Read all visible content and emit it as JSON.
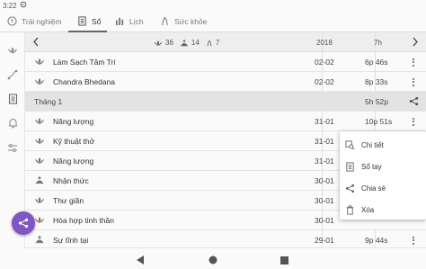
{
  "status": {
    "time": "3:22"
  },
  "tabs": [
    {
      "label": "Trải nghiệm",
      "icon": "compass-icon"
    },
    {
      "label": "Sổ",
      "icon": "journal-icon",
      "active": true
    },
    {
      "label": "Lịch",
      "icon": "bar-chart-icon"
    },
    {
      "label": "Sức khỏe",
      "icon": "health-icon"
    }
  ],
  "header": {
    "counts": [
      "36",
      "14",
      "7"
    ],
    "year": "2018",
    "hours": "7h"
  },
  "rows": [
    {
      "name": "Làm Sạch Tâm Trí",
      "date": "02-02",
      "duration": "6p 46s",
      "icon": "lotus-icon"
    },
    {
      "name": "Chandra Bhedana",
      "date": "02-02",
      "duration": "8p 33s",
      "icon": "lotus-icon"
    },
    {
      "name": "Năng lượng",
      "date": "31-01",
      "duration": "10p 51s",
      "icon": "lotus-icon"
    },
    {
      "name": "Kỹ thuật thở",
      "date": "31-01",
      "duration": "",
      "icon": "lotus-icon"
    },
    {
      "name": "Năng lượng",
      "date": "31-01",
      "duration": "",
      "icon": "lotus-icon"
    },
    {
      "name": "Nhận thức",
      "date": "30-01",
      "duration": "",
      "icon": "meditation-icon"
    },
    {
      "name": "Thư giãn",
      "date": "30-01",
      "duration": "",
      "icon": "lotus-icon"
    },
    {
      "name": "Hòa hợp tinh thần",
      "date": "30-01",
      "duration": "",
      "icon": "lotus-icon"
    },
    {
      "name": "Sự tĩnh tại",
      "date": "29-01",
      "duration": "9p 44s",
      "icon": "meditation-icon"
    }
  ],
  "month": {
    "label": "Tháng 1",
    "total": "5h 52p"
  },
  "popup": {
    "items": [
      {
        "label": "Chi tiết",
        "icon": "details-icon"
      },
      {
        "label": "Sổ tay",
        "icon": "notebook-icon"
      },
      {
        "label": "Chia sẻ",
        "icon": "share-icon"
      },
      {
        "label": "Xóa",
        "icon": "trash-icon"
      }
    ]
  },
  "colors": {
    "accent": "#7e57c2",
    "month_bg": "#e3e3e3",
    "header_bg": "#eeeeee"
  }
}
